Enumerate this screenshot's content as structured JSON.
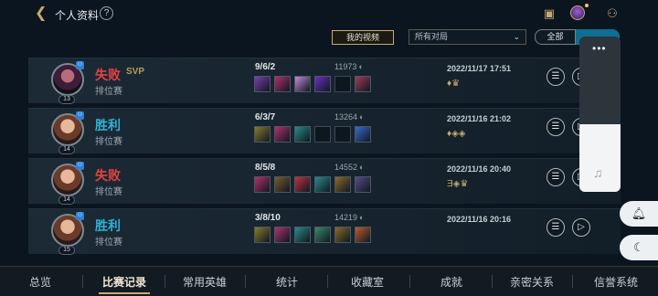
{
  "header": {
    "back_icon": "chevron-left-icon",
    "title": "个人资料",
    "help": "?",
    "icons": [
      "task-icon",
      "profile-avatar",
      "friends-icon"
    ]
  },
  "toolbar": {
    "my_videos": "我的视频",
    "time_filter": "所有对局",
    "seg_all": "全部"
  },
  "matches": [
    {
      "result": "失败",
      "svp": "SVP",
      "mode": "排位赛",
      "level": "13",
      "kda": "9/6/2",
      "gold": "11973",
      "date": "2022/11/17 17:51",
      "honors": "♦♛"
    },
    {
      "result": "胜利",
      "svp": "",
      "mode": "排位赛",
      "level": "14",
      "kda": "6/3/7",
      "gold": "13264",
      "date": "2022/11/16 21:02",
      "honors": "♦◈◈"
    },
    {
      "result": "失败",
      "svp": "",
      "mode": "排位赛",
      "level": "14",
      "kda": "8/5/8",
      "gold": "14552",
      "date": "2022/11/16 20:40",
      "honors": "Ǝ◈♛"
    },
    {
      "result": "胜利",
      "svp": "",
      "mode": "排位赛",
      "level": "15",
      "kda": "3/8/10",
      "gold": "14219",
      "date": "2022/11/16 20:16",
      "honors": ""
    }
  ],
  "item_colors": [
    [
      "#7a3fb0",
      "#b0306f",
      "#c48ad8",
      "#6a2fc0",
      "",
      "#a13a5a"
    ],
    [
      "#8a7a2a",
      "#b0306f",
      "#2a8a8a",
      "",
      "",
      "#3a6ad0"
    ],
    [
      "#b0306f",
      "#7a5a2a",
      "#c03040",
      "#2a8a8a",
      "#8a6a2a",
      "#5a4a8a"
    ],
    [
      "#8a7a2a",
      "#b0306f",
      "#2a8a8a",
      "#3a8a6a",
      "#8a6a2a",
      "#c05a2a"
    ]
  ],
  "overlay": {
    "menu": "•••",
    "music_icon": "♫"
  },
  "side_buttons": [
    "bell-icon",
    "moon-icon"
  ],
  "nav": [
    "总览",
    "比赛记录",
    "常用英雄",
    "统计",
    "收藏室",
    "成就",
    "亲密关系",
    "信誉系统"
  ]
}
